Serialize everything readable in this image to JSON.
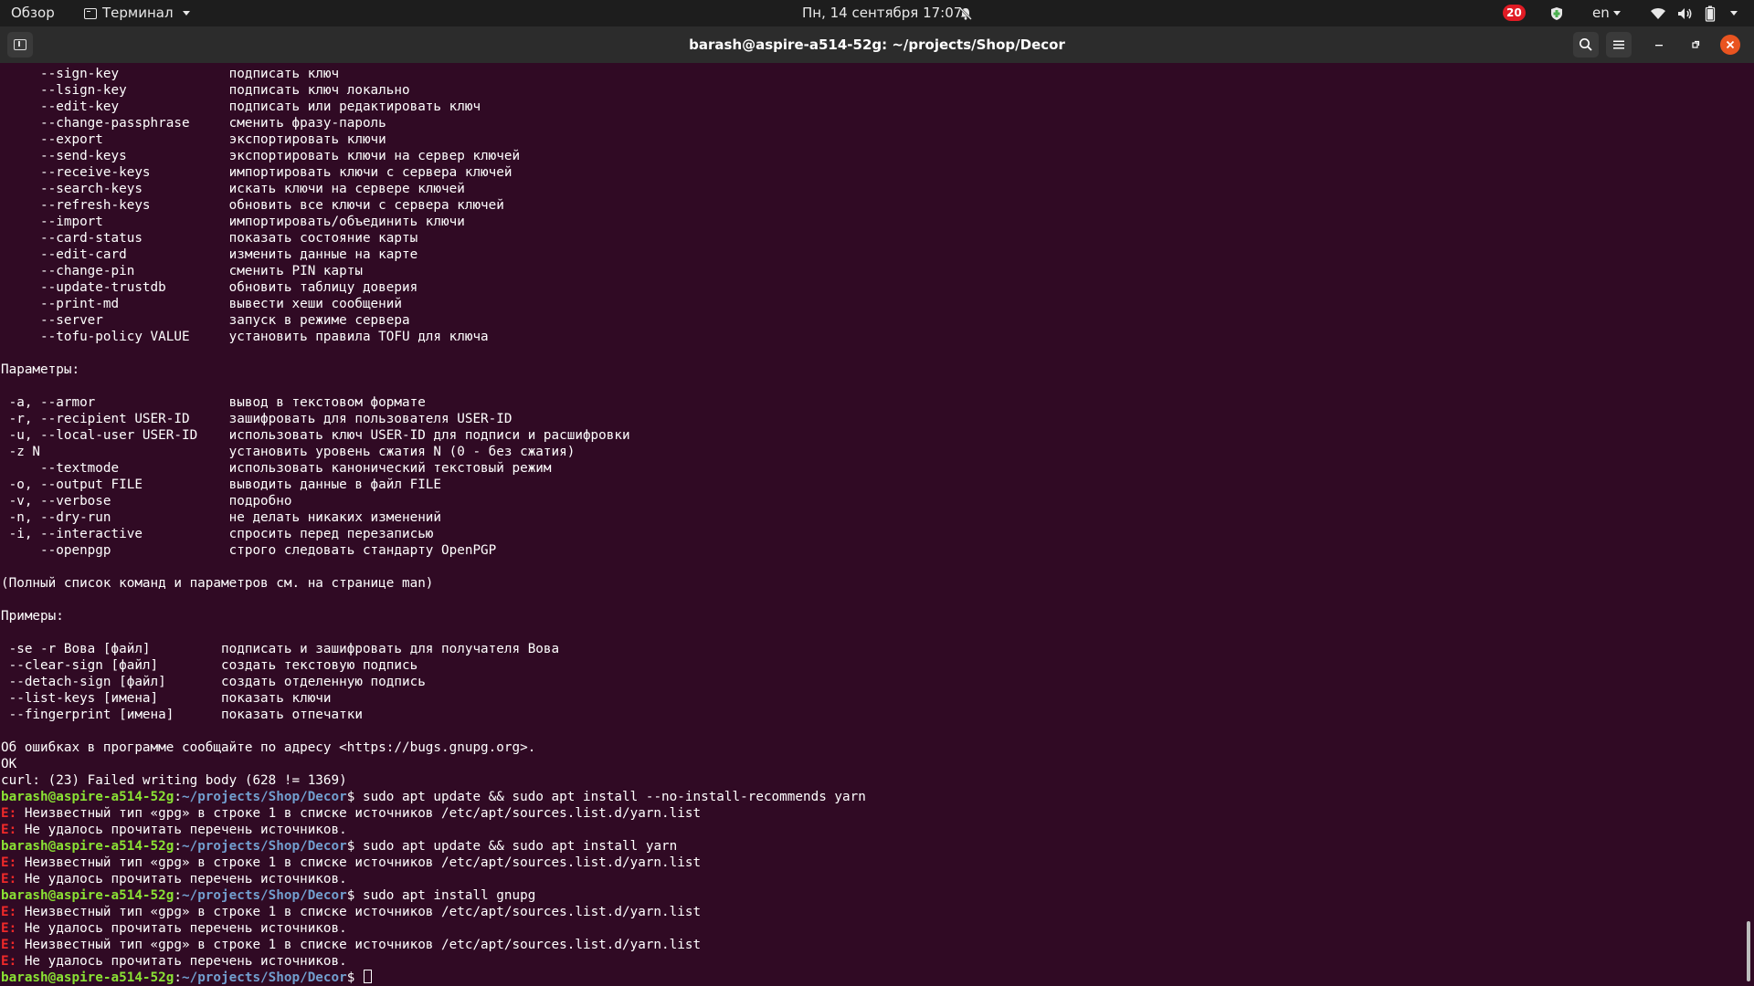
{
  "topbar": {
    "activities": "Обзор",
    "app_name": "Терминал",
    "datetime": "Пн, 14 сентября  17:07",
    "notification_count": "20",
    "language": "en"
  },
  "window": {
    "title": "barash@aspire-a514-52g: ~/projects/Shop/Decor"
  },
  "terminal": {
    "lines": [
      {
        "type": "text",
        "text": "     --sign-key              подписать ключ"
      },
      {
        "type": "text",
        "text": "     --lsign-key             подписать ключ локально"
      },
      {
        "type": "text",
        "text": "     --edit-key              подписать или редактировать ключ"
      },
      {
        "type": "text",
        "text": "     --change-passphrase     сменить фразу-пароль"
      },
      {
        "type": "text",
        "text": "     --export                экспортировать ключи"
      },
      {
        "type": "text",
        "text": "     --send-keys             экспортировать ключи на сервер ключей"
      },
      {
        "type": "text",
        "text": "     --receive-keys          импортировать ключи с сервера ключей"
      },
      {
        "type": "text",
        "text": "     --search-keys           искать ключи на сервере ключей"
      },
      {
        "type": "text",
        "text": "     --refresh-keys          обновить все ключи с сервера ключей"
      },
      {
        "type": "text",
        "text": "     --import                импортировать/объединить ключи"
      },
      {
        "type": "text",
        "text": "     --card-status           показать состояние карты"
      },
      {
        "type": "text",
        "text": "     --edit-card             изменить данные на карте"
      },
      {
        "type": "text",
        "text": "     --change-pin            сменить PIN карты"
      },
      {
        "type": "text",
        "text": "     --update-trustdb        обновить таблицу доверия"
      },
      {
        "type": "text",
        "text": "     --print-md              вывести хеши сообщений"
      },
      {
        "type": "text",
        "text": "     --server                запуск в режиме сервера"
      },
      {
        "type": "text",
        "text": "     --tofu-policy VALUE     установить правила TOFU для ключа"
      },
      {
        "type": "text",
        "text": ""
      },
      {
        "type": "text",
        "text": "Параметры:"
      },
      {
        "type": "text",
        "text": ""
      },
      {
        "type": "text",
        "text": " -a, --armor                 вывод в текстовом формате"
      },
      {
        "type": "text",
        "text": " -r, --recipient USER-ID     зашифровать для пользователя USER-ID"
      },
      {
        "type": "text",
        "text": " -u, --local-user USER-ID    использовать ключ USER-ID для подписи и расшифровки"
      },
      {
        "type": "text",
        "text": " -z N                        установить уровень сжатия N (0 - без сжатия)"
      },
      {
        "type": "text",
        "text": "     --textmode              использовать канонический текстовый режим"
      },
      {
        "type": "text",
        "text": " -o, --output FILE           выводить данные в файл FILE"
      },
      {
        "type": "text",
        "text": " -v, --verbose               подробно"
      },
      {
        "type": "text",
        "text": " -n, --dry-run               не делать никаких изменений"
      },
      {
        "type": "text",
        "text": " -i, --interactive           спросить перед перезаписью"
      },
      {
        "type": "text",
        "text": "     --openpgp               строго следовать стандарту OpenPGP"
      },
      {
        "type": "text",
        "text": ""
      },
      {
        "type": "text",
        "text": "(Полный список команд и параметров см. на странице man)"
      },
      {
        "type": "text",
        "text": ""
      },
      {
        "type": "text",
        "text": "Примеры:"
      },
      {
        "type": "text",
        "text": ""
      },
      {
        "type": "text",
        "text": " -se -r Вова [файл]         подписать и зашифровать для получателя Вова"
      },
      {
        "type": "text",
        "text": " --clear-sign [файл]        создать текстовую подпись"
      },
      {
        "type": "text",
        "text": " --detach-sign [файл]       создать отделенную подпись"
      },
      {
        "type": "text",
        "text": " --list-keys [имена]        показать ключи"
      },
      {
        "type": "text",
        "text": " --fingerprint [имена]      показать отпечатки"
      },
      {
        "type": "text",
        "text": ""
      },
      {
        "type": "text",
        "text": "Об ошибках в программе сообщайте по адресу <https://bugs.gnupg.org>."
      },
      {
        "type": "text",
        "text": "OK"
      },
      {
        "type": "text",
        "text": "curl: (23) Failed writing body (628 != 1369)"
      },
      {
        "type": "prompt",
        "user": "barash@aspire-a514-52g",
        "sep": ":",
        "path": "~/projects/Shop/Decor",
        "cmd": "$ sudo apt update && sudo apt install --no-install-recommends yarn"
      },
      {
        "type": "error",
        "label": "E:",
        "text": " Неизвестный тип «gpg» в строке 1 в списке источников /etc/apt/sources.list.d/yarn.list"
      },
      {
        "type": "error",
        "label": "E:",
        "text": " Не удалось прочитать перечень источников."
      },
      {
        "type": "prompt",
        "user": "barash@aspire-a514-52g",
        "sep": ":",
        "path": "~/projects/Shop/Decor",
        "cmd": "$ sudo apt update && sudo apt install yarn"
      },
      {
        "type": "error",
        "label": "E:",
        "text": " Неизвестный тип «gpg» в строке 1 в списке источников /etc/apt/sources.list.d/yarn.list"
      },
      {
        "type": "error",
        "label": "E:",
        "text": " Не удалось прочитать перечень источников."
      },
      {
        "type": "prompt",
        "user": "barash@aspire-a514-52g",
        "sep": ":",
        "path": "~/projects/Shop/Decor",
        "cmd": "$ sudo apt install gnupg"
      },
      {
        "type": "error",
        "label": "E:",
        "text": " Неизвестный тип «gpg» в строке 1 в списке источников /etc/apt/sources.list.d/yarn.list"
      },
      {
        "type": "error",
        "label": "E:",
        "text": " Не удалось прочитать перечень источников."
      },
      {
        "type": "error",
        "label": "E:",
        "text": " Неизвестный тип «gpg» в строке 1 в списке источников /etc/apt/sources.list.d/yarn.list"
      },
      {
        "type": "error",
        "label": "E:",
        "text": " Не удалось прочитать перечень источников."
      },
      {
        "type": "prompt",
        "user": "barash@aspire-a514-52g",
        "sep": ":",
        "path": "~/projects/Shop/Decor",
        "cmd": "$ ",
        "cursor": true
      }
    ]
  },
  "colors": {
    "terminal_bg": "#300a24",
    "prompt_user": "#8ae234",
    "prompt_path": "#729fcf",
    "error_label": "#ef2929",
    "close_button": "#e95420"
  }
}
